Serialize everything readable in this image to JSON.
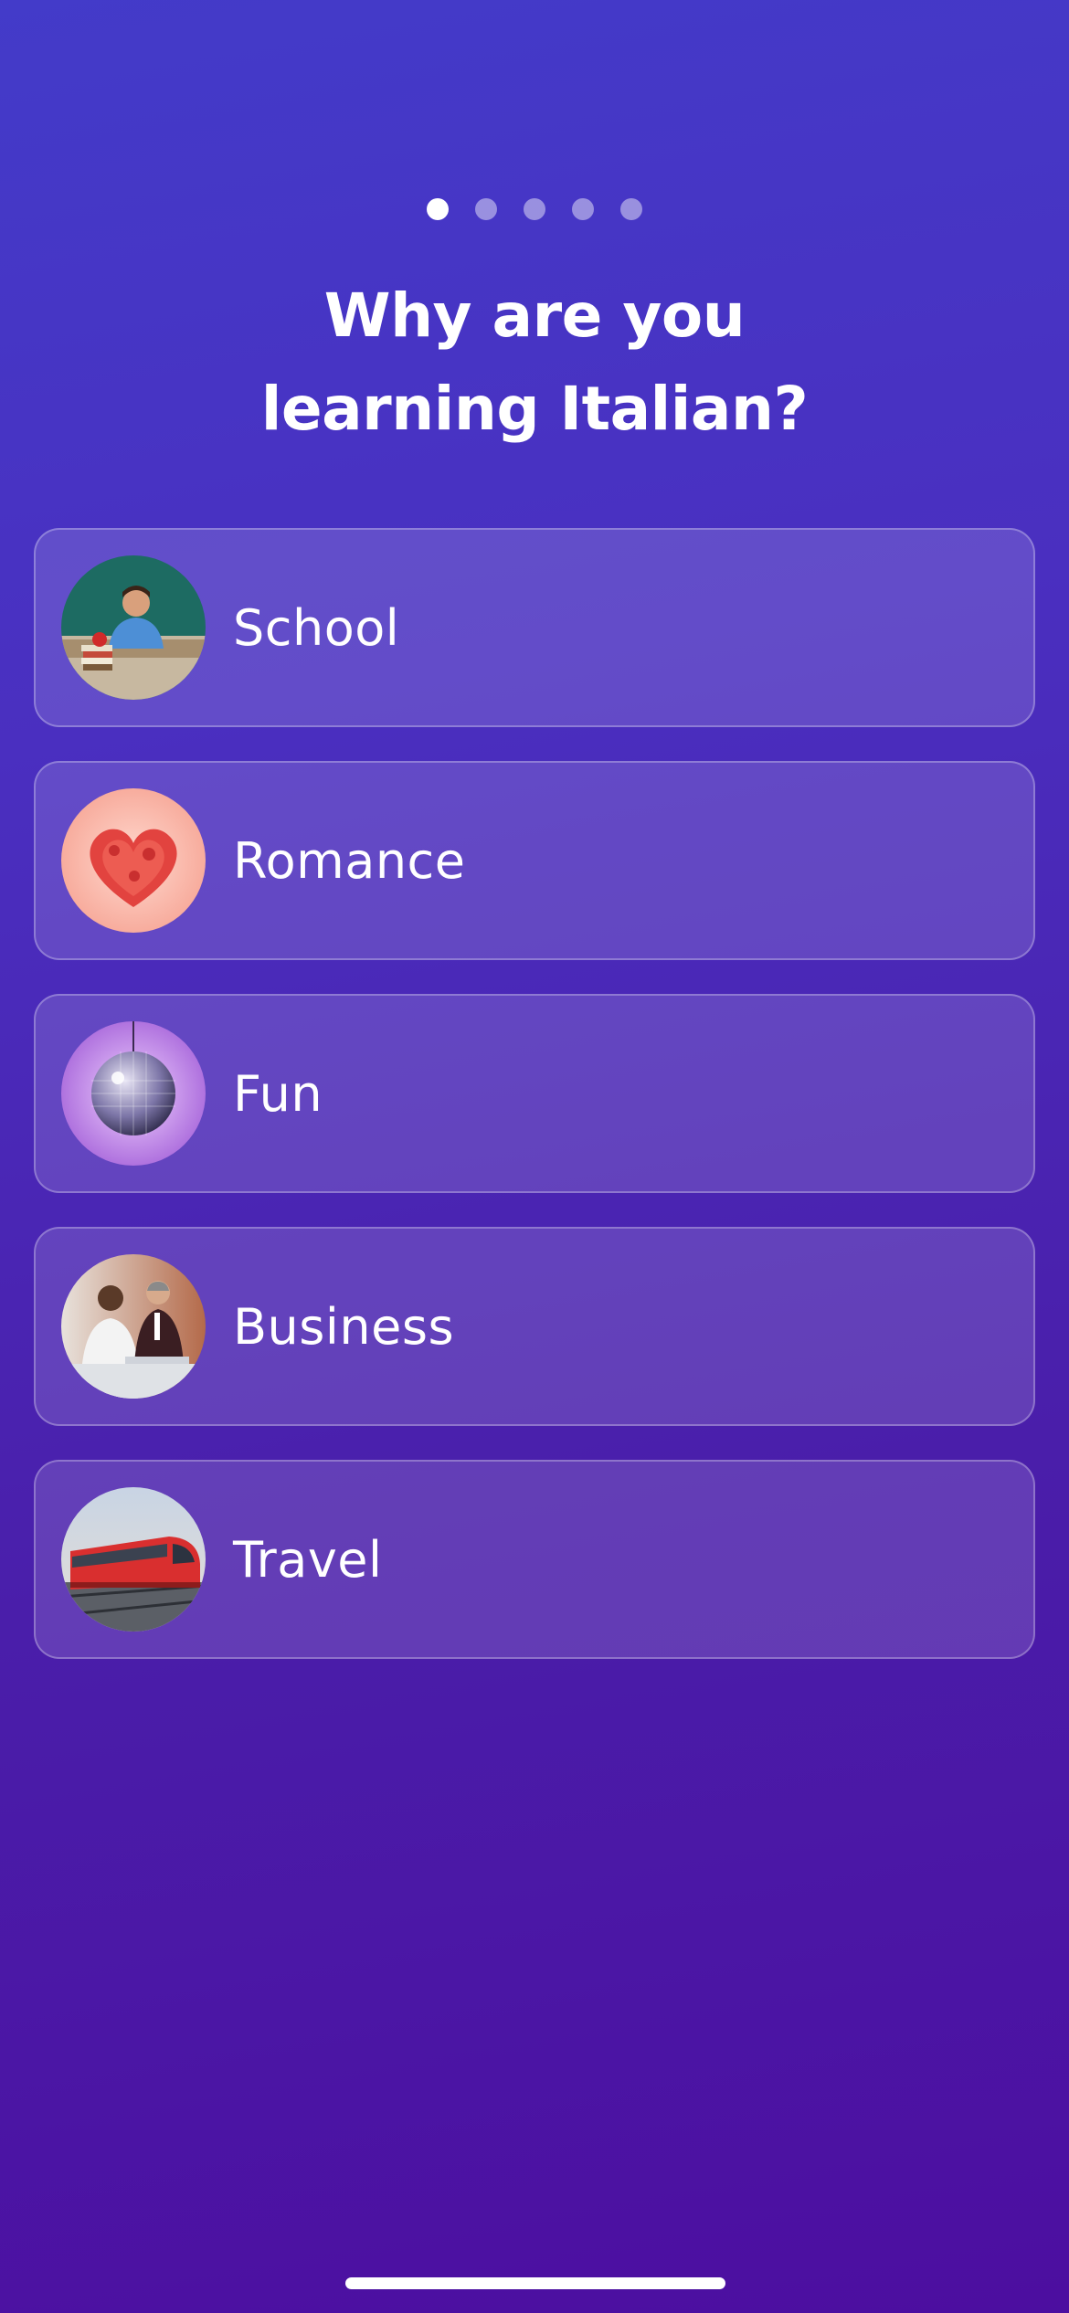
{
  "progress": {
    "total_steps": 5,
    "current_step": 1
  },
  "title": {
    "line1": "Why are you",
    "line2": "learning Italian?"
  },
  "options": [
    {
      "label": "School",
      "image": "teacher-at-desk-illustration"
    },
    {
      "label": "Romance",
      "image": "heart-illustration"
    },
    {
      "label": "Fun",
      "image": "disco-ball-illustration"
    },
    {
      "label": "Business",
      "image": "business-meeting-illustration"
    },
    {
      "label": "Travel",
      "image": "train-illustration"
    }
  ],
  "colors": {
    "background_top": "#433bc9",
    "background_bottom": "#4c0ea0",
    "card_fill": "rgba(255,255,255,0.14)",
    "text": "#ffffff"
  }
}
